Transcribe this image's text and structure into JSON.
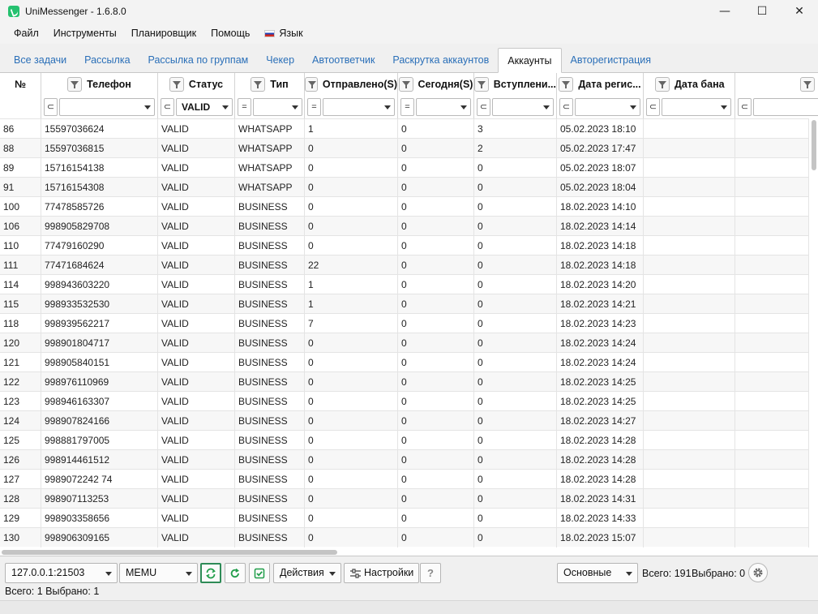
{
  "window": {
    "title": "UniMessenger - 1.6.8.0"
  },
  "menu": [
    "Файл",
    "Инструменты",
    "Планировщик",
    "Помощь",
    "Язык"
  ],
  "tabs": [
    {
      "label": "Все задачи",
      "active": false
    },
    {
      "label": "Рассылка",
      "active": false
    },
    {
      "label": "Рассылка по группам",
      "active": false
    },
    {
      "label": "Чекер",
      "active": false
    },
    {
      "label": "Автоответчик",
      "active": false
    },
    {
      "label": "Раскрутка аккаунтов",
      "active": false
    },
    {
      "label": "Аккаунты",
      "active": true
    },
    {
      "label": "Авторегистрация",
      "active": false
    }
  ],
  "columns": [
    "№",
    "Телефон",
    "Статус",
    "Тип",
    "Отправлено(S)",
    "Сегодня(S)",
    "Вступлени...",
    "Дата регис...",
    "Дата бана"
  ],
  "filters": {
    "status_value": "VALID",
    "ops": [
      "⊂",
      "⊂",
      "⊂",
      "=",
      "=",
      "=",
      "⊂",
      "⊂",
      "⊂"
    ]
  },
  "rows": [
    [
      "86",
      "15597036624",
      "VALID",
      "WHATSAPP",
      "1",
      "0",
      "3",
      "05.02.2023 18:10",
      ""
    ],
    [
      "88",
      "15597036815",
      "VALID",
      "WHATSAPP",
      "0",
      "0",
      "2",
      "05.02.2023 17:47",
      ""
    ],
    [
      "89",
      "15716154138",
      "VALID",
      "WHATSAPP",
      "0",
      "0",
      "0",
      "05.02.2023 18:07",
      ""
    ],
    [
      "91",
      "15716154308",
      "VALID",
      "WHATSAPP",
      "0",
      "0",
      "0",
      "05.02.2023 18:04",
      ""
    ],
    [
      "100",
      "77478585726",
      "VALID",
      "BUSINESS",
      "0",
      "0",
      "0",
      "18.02.2023 14:10",
      ""
    ],
    [
      "106",
      "998905829708",
      "VALID",
      "BUSINESS",
      "0",
      "0",
      "0",
      "18.02.2023 14:14",
      ""
    ],
    [
      "110",
      "77479160290",
      "VALID",
      "BUSINESS",
      "0",
      "0",
      "0",
      "18.02.2023 14:18",
      ""
    ],
    [
      "111",
      "77471684624",
      "VALID",
      "BUSINESS",
      "22",
      "0",
      "0",
      "18.02.2023 14:18",
      ""
    ],
    [
      "114",
      "998943603220",
      "VALID",
      "BUSINESS",
      "1",
      "0",
      "0",
      "18.02.2023 14:20",
      ""
    ],
    [
      "115",
      "998933532530",
      "VALID",
      "BUSINESS",
      "1",
      "0",
      "0",
      "18.02.2023 14:21",
      ""
    ],
    [
      "118",
      "998939562217",
      "VALID",
      "BUSINESS",
      "7",
      "0",
      "0",
      "18.02.2023 14:23",
      ""
    ],
    [
      "120",
      "998901804717",
      "VALID",
      "BUSINESS",
      "0",
      "0",
      "0",
      "18.02.2023 14:24",
      ""
    ],
    [
      "121",
      "998905840151",
      "VALID",
      "BUSINESS",
      "0",
      "0",
      "0",
      "18.02.2023 14:24",
      ""
    ],
    [
      "122",
      "998976110969",
      "VALID",
      "BUSINESS",
      "0",
      "0",
      "0",
      "18.02.2023 14:25",
      ""
    ],
    [
      "123",
      "998946163307",
      "VALID",
      "BUSINESS",
      "0",
      "0",
      "0",
      "18.02.2023 14:25",
      ""
    ],
    [
      "124",
      "998907824166",
      "VALID",
      "BUSINESS",
      "0",
      "0",
      "0",
      "18.02.2023 14:27",
      ""
    ],
    [
      "125",
      "998881797005",
      "VALID",
      "BUSINESS",
      "0",
      "0",
      "0",
      "18.02.2023 14:28",
      ""
    ],
    [
      "126",
      "998914461512",
      "VALID",
      "BUSINESS",
      "0",
      "0",
      "0",
      "18.02.2023 14:28",
      ""
    ],
    [
      "127",
      "9989072242 74",
      "VALID",
      "BUSINESS",
      "0",
      "0",
      "0",
      "18.02.2023 14:28",
      ""
    ],
    [
      "128",
      "998907113253",
      "VALID",
      "BUSINESS",
      "0",
      "0",
      "0",
      "18.02.2023 14:31",
      ""
    ],
    [
      "129",
      "998903358656",
      "VALID",
      "BUSINESS",
      "0",
      "0",
      "0",
      "18.02.2023 14:33",
      ""
    ],
    [
      "130",
      "998906309165",
      "VALID",
      "BUSINESS",
      "0",
      "0",
      "0",
      "18.02.2023 15:07",
      ""
    ]
  ],
  "toolbar": {
    "address": "127.0.0.1:21503",
    "emulator": "MEMU",
    "actions_label": "Действия",
    "settings_label": "Настройки",
    "help_label": "?",
    "view_mode": "Основные",
    "total_label": "Всего: 191",
    "selected_label": "Выбрано: 0"
  },
  "status": {
    "text": "Всего: 1  Выбрано: 1"
  }
}
